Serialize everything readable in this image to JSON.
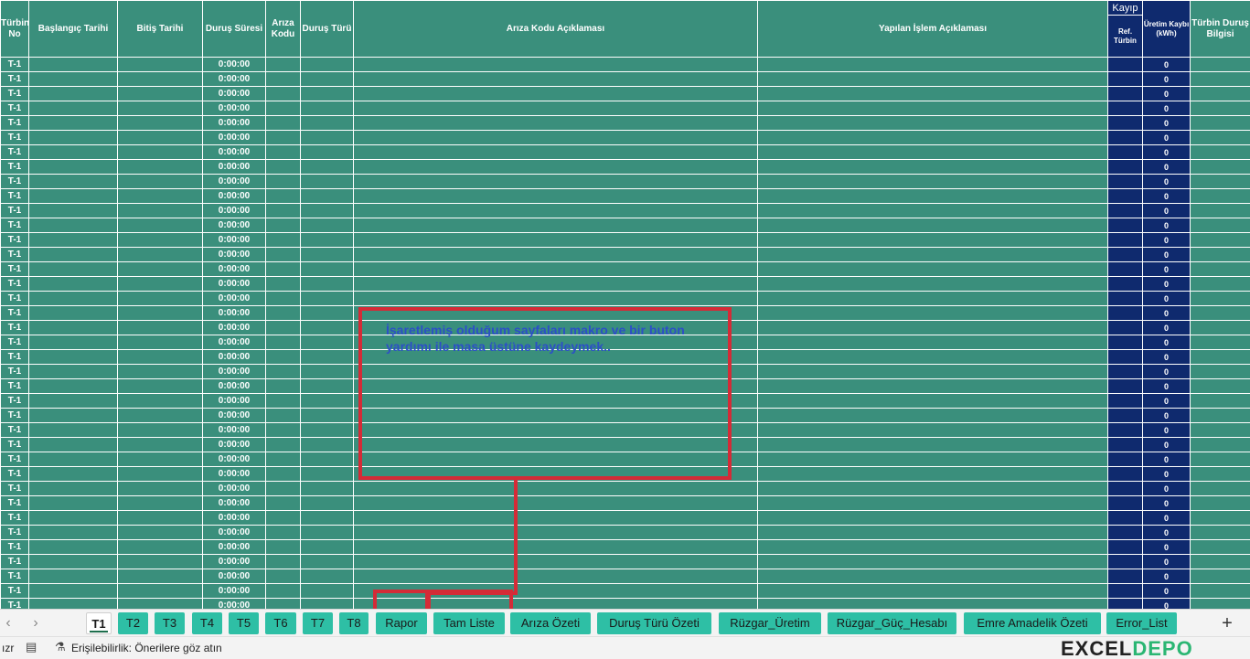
{
  "columns": {
    "turbin_no": "Türbin No",
    "baslangic": "Başlangıç Tarihi",
    "bitis": "Bitiş Tarihi",
    "durus_suresi": "Duruş Süresi",
    "ariza_kodu": "Arıza Kodu",
    "durus_turu": "Duruş Türü",
    "ariza_aciklama": "Arıza Kodu Açıklaması",
    "islem_aciklama": "Yapılan İşlem Açıklaması",
    "kayip_group": "Kayıp",
    "ref_turbin": "Ref. Türbin",
    "uretim_kaybi": "Üretim Kaybı (kWh)",
    "turbin_durus_bilgisi": "Türbin Duruş Bilgisi"
  },
  "row_defaults": {
    "turbin": "T-1",
    "durus_suresi": "0:00:00",
    "uretim_kaybi": "0"
  },
  "rows": [
    {
      "turbin": "T-1",
      "durus_suresi": "0:00:00",
      "uretim_kaybi": "0"
    },
    {
      "turbin": "T-1",
      "durus_suresi": "0:00:00",
      "uretim_kaybi": "0"
    },
    {
      "turbin": "T-1",
      "durus_suresi": "0:00:00",
      "uretim_kaybi": "0"
    },
    {
      "turbin": "T-1",
      "durus_suresi": "0:00:00",
      "uretim_kaybi": "0"
    },
    {
      "turbin": "T-1",
      "durus_suresi": "0:00:00",
      "uretim_kaybi": "0"
    },
    {
      "turbin": "T-1",
      "durus_suresi": "0:00:00",
      "uretim_kaybi": "0"
    },
    {
      "turbin": "T-1",
      "durus_suresi": "0:00:00",
      "uretim_kaybi": "0"
    },
    {
      "turbin": "T-1",
      "durus_suresi": "0:00:00",
      "uretim_kaybi": "0"
    },
    {
      "turbin": "T-1",
      "durus_suresi": "0:00:00",
      "uretim_kaybi": "0"
    },
    {
      "turbin": "T-1",
      "durus_suresi": "0:00:00",
      "uretim_kaybi": "0"
    },
    {
      "turbin": "T-1",
      "durus_suresi": "0:00:00",
      "uretim_kaybi": "0"
    },
    {
      "turbin": "T-1",
      "durus_suresi": "0:00:00",
      "uretim_kaybi": "0"
    },
    {
      "turbin": "T-1",
      "durus_suresi": "0:00:00",
      "uretim_kaybi": "0"
    },
    {
      "turbin": "T-1",
      "durus_suresi": "0:00:00",
      "uretim_kaybi": "0"
    },
    {
      "turbin": "T-1",
      "durus_suresi": "0:00:00",
      "uretim_kaybi": "0"
    },
    {
      "turbin": "T-1",
      "durus_suresi": "0:00:00",
      "uretim_kaybi": "0"
    },
    {
      "turbin": "T-1",
      "durus_suresi": "0:00:00",
      "uretim_kaybi": "0"
    },
    {
      "turbin": "T-1",
      "durus_suresi": "0:00:00",
      "uretim_kaybi": "0"
    },
    {
      "turbin": "T-1",
      "durus_suresi": "0:00:00",
      "uretim_kaybi": "0"
    },
    {
      "turbin": "T-1",
      "durus_suresi": "0:00:00",
      "uretim_kaybi": "0"
    },
    {
      "turbin": "T-1",
      "durus_suresi": "0:00:00",
      "uretim_kaybi": "0"
    },
    {
      "turbin": "T-1",
      "durus_suresi": "0:00:00",
      "uretim_kaybi": "0"
    },
    {
      "turbin": "T-1",
      "durus_suresi": "0:00:00",
      "uretim_kaybi": "0"
    },
    {
      "turbin": "T-1",
      "durus_suresi": "0:00:00",
      "uretim_kaybi": "0"
    },
    {
      "turbin": "T-1",
      "durus_suresi": "0:00:00",
      "uretim_kaybi": "0"
    },
    {
      "turbin": "T-1",
      "durus_suresi": "0:00:00",
      "uretim_kaybi": "0"
    },
    {
      "turbin": "T-1",
      "durus_suresi": "0:00:00",
      "uretim_kaybi": "0"
    },
    {
      "turbin": "T-1",
      "durus_suresi": "0:00:00",
      "uretim_kaybi": "0"
    },
    {
      "turbin": "T-1",
      "durus_suresi": "0:00:00",
      "uretim_kaybi": "0"
    },
    {
      "turbin": "T-1",
      "durus_suresi": "0:00:00",
      "uretim_kaybi": "0"
    },
    {
      "turbin": "T-1",
      "durus_suresi": "0:00:00",
      "uretim_kaybi": "0"
    },
    {
      "turbin": "T-1",
      "durus_suresi": "0:00:00",
      "uretim_kaybi": "0"
    },
    {
      "turbin": "T-1",
      "durus_suresi": "0:00:00",
      "uretim_kaybi": "0"
    },
    {
      "turbin": "T-1",
      "durus_suresi": "0:00:00",
      "uretim_kaybi": "0"
    },
    {
      "turbin": "T-1",
      "durus_suresi": "0:00:00",
      "uretim_kaybi": "0"
    },
    {
      "turbin": "T-1",
      "durus_suresi": "0:00:00",
      "uretim_kaybi": "0"
    },
    {
      "turbin": "T-1",
      "durus_suresi": "0:00:00",
      "uretim_kaybi": "0"
    },
    {
      "turbin": "T-1",
      "durus_suresi": "0:00:00",
      "uretim_kaybi": "0"
    },
    {
      "turbin": "T-1",
      "durus_suresi": "0:00:00",
      "uretim_kaybi": "0"
    }
  ],
  "annotation": {
    "text": "İşaretlemiş olduğum sayfaları makro ve bir buton yardımı ile masa üstüne kaydeymek..",
    "color": "#d42b37"
  },
  "sheet_tabs": [
    {
      "label": "T1",
      "active": true
    },
    {
      "label": "T2",
      "active": false
    },
    {
      "label": "T3",
      "active": false
    },
    {
      "label": "T4",
      "active": false
    },
    {
      "label": "T5",
      "active": false
    },
    {
      "label": "T6",
      "active": false
    },
    {
      "label": "T7",
      "active": false
    },
    {
      "label": "T8",
      "active": false
    },
    {
      "label": "Rapor",
      "active": false
    },
    {
      "label": "Tam Liste",
      "active": false
    },
    {
      "label": "Arıza Özeti",
      "active": false
    },
    {
      "label": "Duruş Türü Özeti",
      "active": false
    },
    {
      "label": "Rüzgar_Üretim",
      "active": false
    },
    {
      "label": "Rüzgar_Güç_Hesabı",
      "active": false
    },
    {
      "label": "Emre Amadelik Özeti",
      "active": false
    },
    {
      "label": "Error_List",
      "active": false
    }
  ],
  "nav": {
    "prev": "‹",
    "next": "›",
    "add": "+"
  },
  "status": {
    "left": "ızr",
    "accessibility": "Erişilebilirlik: Önerilere göz atın"
  },
  "logo": {
    "part1": "EXCEL",
    "part2": "DEPO"
  },
  "colors": {
    "grid_green": "#3a8f7c",
    "navy": "#0f2a6e",
    "tab_teal": "#2ebfa5",
    "accent_red": "#d42b37",
    "annotation_blue": "#2c4fc7"
  },
  "icons": {
    "status": "macro-record-icon",
    "accessibility": "accessibility-icon"
  }
}
